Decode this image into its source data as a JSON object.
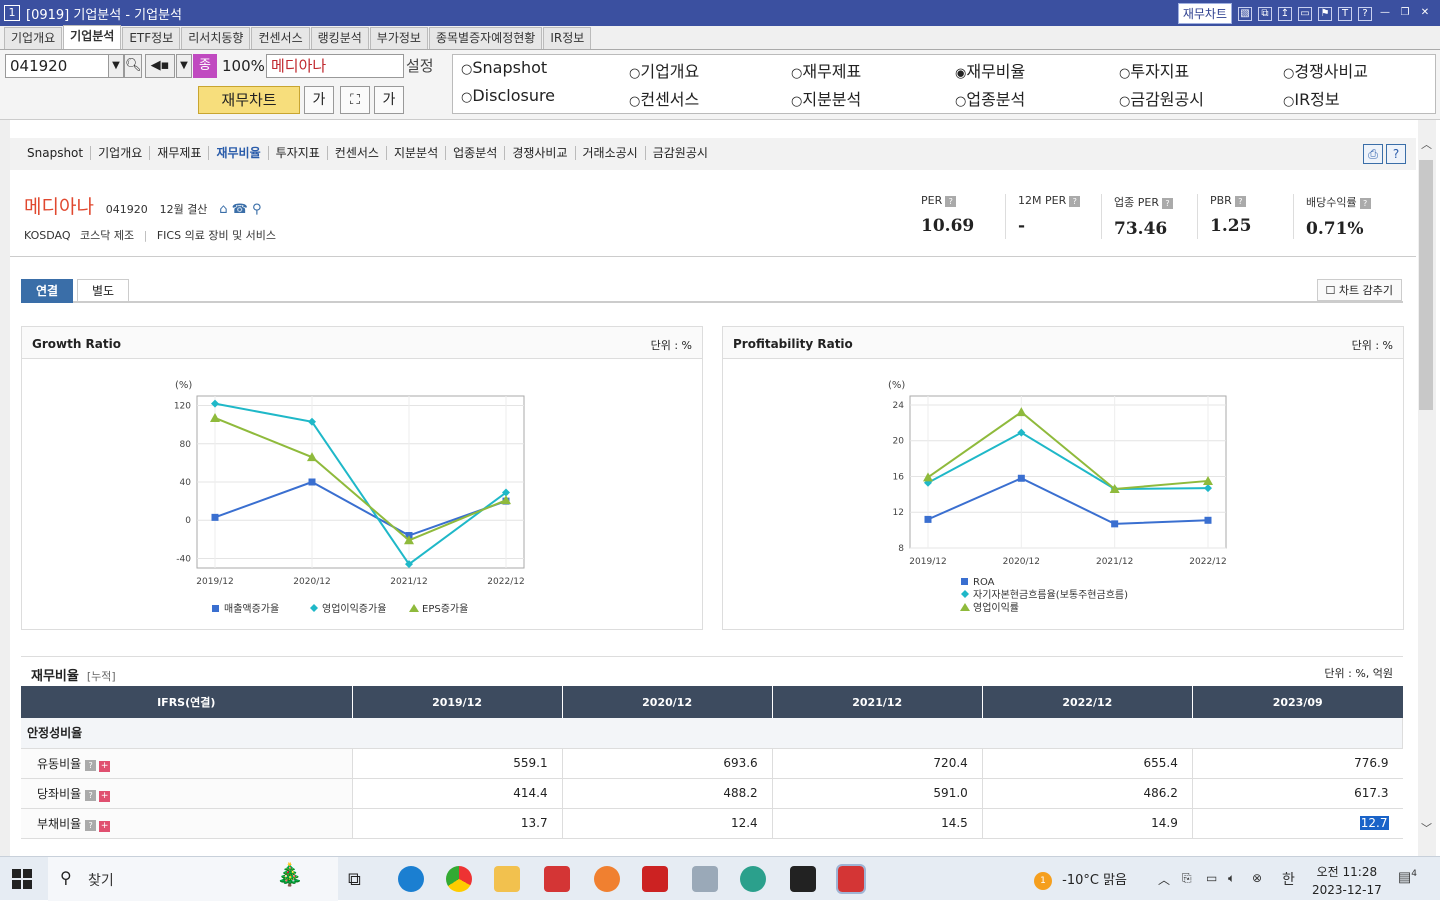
{
  "titlebar": {
    "winnum": "1",
    "title": "[0919] 기업분석 - 기업분석",
    "chip": "재무차트",
    "icons": [
      "chart-icon",
      "tile-icon",
      "pin-icon",
      "window-icon",
      "flag-icon",
      "font-icon",
      "help-icon",
      "minimize-icon",
      "restore-icon",
      "close-icon"
    ]
  },
  "tabs": [
    "기업개요",
    "기업분석",
    "ETF정보",
    "리서치동향",
    "컨센서스",
    "랭킹분석",
    "부가정보",
    "종목별증자예정현황",
    "IR정보"
  ],
  "toolbar": {
    "code": "041920",
    "badge": "종",
    "zoom": "100%",
    "stock_name": "메디아나",
    "setting": "설정",
    "chart_button": "재무차트",
    "font_small": "가",
    "font_large": "가"
  },
  "radios": [
    {
      "label": "Snapshot",
      "checked": false
    },
    {
      "label": "기업개요",
      "checked": false
    },
    {
      "label": "재무제표",
      "checked": false
    },
    {
      "label": "재무비율",
      "checked": true
    },
    {
      "label": "투자지표",
      "checked": false
    },
    {
      "label": "경쟁사비교",
      "checked": false
    },
    {
      "label": "Disclosure",
      "checked": false
    },
    {
      "label": "컨센서스",
      "checked": false
    },
    {
      "label": "지분분석",
      "checked": false
    },
    {
      "label": "업종분석",
      "checked": false
    },
    {
      "label": "금감원공시",
      "checked": false
    },
    {
      "label": "IR정보",
      "checked": false
    }
  ],
  "nav": [
    "Snapshot",
    "기업개요",
    "재무제표",
    "재무비율",
    "투자지표",
    "컨센서스",
    "지분분석",
    "업종분석",
    "경쟁사비교",
    "거래소공시",
    "금감원공시"
  ],
  "nav_active": "재무비율",
  "company": {
    "name": "메디아나",
    "code": "041920",
    "fiscal": "12월 결산",
    "market": "KOSDAQ",
    "market_sub": "코스닥 제조",
    "fics": "FICS 의료 장비 및 서비스"
  },
  "metrics": [
    {
      "label": "PER",
      "value": "10.69"
    },
    {
      "label": "12M PER",
      "value": "-"
    },
    {
      "label": "업종 PER",
      "value": "73.46"
    },
    {
      "label": "PBR",
      "value": "1.25"
    },
    {
      "label": "배당수익률",
      "value": "0.71%"
    }
  ],
  "subtabs": {
    "consolidated": "연결",
    "separate": "별도",
    "hide": "차트 감추기"
  },
  "panels": {
    "growth": {
      "title": "Growth Ratio",
      "unit": "단위 : %"
    },
    "profit": {
      "title": "Profitability Ratio",
      "unit": "단위 : %"
    }
  },
  "chart_data": [
    {
      "type": "line",
      "title": "Growth Ratio",
      "ylabel": "(%)",
      "categories": [
        "2019/12",
        "2020/12",
        "2021/12",
        "2022/12"
      ],
      "ylim": [
        -50,
        130
      ],
      "yticks": [
        120,
        80,
        40,
        0,
        -40
      ],
      "series": [
        {
          "name": "매출액증가율",
          "color": "#3a6fd0",
          "marker": "square",
          "values": [
            3,
            40,
            -16,
            20
          ]
        },
        {
          "name": "영업이익증가율",
          "color": "#1fb8c8",
          "marker": "diamond",
          "values": [
            122,
            103,
            -46,
            29
          ]
        },
        {
          "name": "EPS증가율",
          "color": "#8fba3c",
          "marker": "triangle",
          "values": [
            107,
            66,
            -21,
            21
          ]
        }
      ],
      "grid": true,
      "legend": "bottom"
    },
    {
      "type": "line",
      "title": "Profitability Ratio",
      "ylabel": "(%)",
      "categories": [
        "2019/12",
        "2020/12",
        "2021/12",
        "2022/12"
      ],
      "ylim": [
        8,
        25
      ],
      "yticks": [
        24,
        20,
        16,
        12,
        8
      ],
      "series": [
        {
          "name": "ROA",
          "color": "#3a6fd0",
          "marker": "square",
          "values": [
            11.2,
            15.8,
            10.7,
            11.1
          ]
        },
        {
          "name": "자기자본현금흐름율(보통주현금흐름)",
          "color": "#1fb8c8",
          "marker": "diamond",
          "values": [
            15.3,
            20.9,
            14.6,
            14.7
          ]
        },
        {
          "name": "영업이익률",
          "color": "#8fba3c",
          "marker": "triangle",
          "values": [
            15.9,
            23.2,
            14.6,
            15.5
          ]
        }
      ],
      "grid": true,
      "legend": "bottom"
    }
  ],
  "table": {
    "title": "재무비율",
    "subtitle": "[누적]",
    "unit": "단위 : %, 억원",
    "head": [
      "IFRS(연결)",
      "2019/12",
      "2020/12",
      "2021/12",
      "2022/12",
      "2023/09"
    ],
    "section": "안정성비율",
    "rows": [
      {
        "label": "유동비율",
        "values": [
          "559.1",
          "693.6",
          "720.4",
          "655.4",
          "776.9"
        ]
      },
      {
        "label": "당좌비율",
        "values": [
          "414.4",
          "488.2",
          "591.0",
          "486.2",
          "617.3"
        ]
      },
      {
        "label": "부채비율",
        "values": [
          "13.7",
          "12.4",
          "14.5",
          "14.9",
          "12.7"
        ]
      }
    ]
  },
  "taskbar": {
    "search": "찾기",
    "weather": "-10°C  맑음",
    "weather_badge": "1",
    "ime": "한",
    "time": "오전 11:28",
    "date": "2023-12-17",
    "notifications": "4"
  }
}
